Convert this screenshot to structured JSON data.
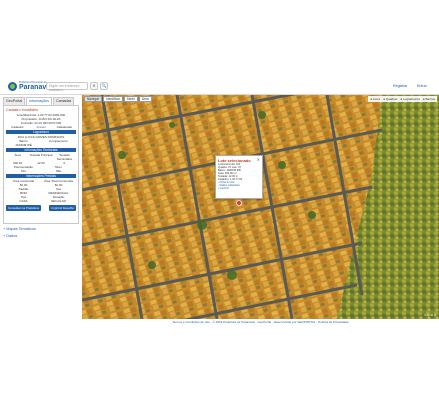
{
  "header": {
    "logo_small": "Prefeitura Municipal de",
    "logo_big": "Paranavaí",
    "search_placeholder": "Digite um endereço, cadastro...",
    "search_btn": "✕",
    "search_go": "🔍",
    "register_link": "Registrar",
    "enter_link": "Entrar"
  },
  "sidebar": {
    "tabs": [
      "GeoPortal",
      "Informações",
      "Camadas"
    ],
    "panel_title": "Cadastro Imobiliário",
    "identity": [
      "Lote/Matrícula: 1.00.77.02.0000.000",
      "Proprietário: JOÃO DA SILVA",
      "Inscrição: 01.02.003.0070.000"
    ],
    "cadastro_row": [
      "Cadastro:",
      "Imóvel",
      "Cadastrado"
    ],
    "sec1": "Logradouro",
    "logradouro": "RUA LUCAS GOMES DOMINGOS",
    "bairro_hdr": [
      "Bairro",
      "Complemento"
    ],
    "bairro_val": [
      "JARDIM IPÊ",
      ""
    ],
    "sec2": "Informações Territoriais",
    "territorio_hdr": [
      "Área",
      "Testada Principal",
      "Testada Secundária"
    ],
    "territorio_val": [
      "300,00",
      "12,00",
      "0"
    ],
    "pav_hdr": [
      "Pavimentação",
      "Muro"
    ],
    "pav_val": [
      "Sim",
      "Não"
    ],
    "sec3": "Informações Prediais",
    "predio_hdr": [
      "Área construída",
      "Área Total Construída"
    ],
    "predio_val": [
      "82,00",
      "82,00"
    ],
    "padrao_hdr": [
      "Padrão",
      "Uso"
    ],
    "padrao_val": [
      "BOM",
      "RESIDENCIAL"
    ],
    "tipo_hdr": [
      "Tipo",
      "Situação"
    ],
    "tipo_val": [
      "CASA",
      "REGULAR"
    ],
    "btn_left": "Consultar na Prefeitura",
    "btn_right": "Imprimir Espelho",
    "collapsed": [
      "Mapas Temáticos",
      "Dados"
    ]
  },
  "map": {
    "toolbar": [
      "Navegar",
      "Identificar",
      "Medir",
      "Área"
    ],
    "layers": [
      "● Lotes",
      "● Quadras",
      "● Logradouros",
      "● Bairros"
    ],
    "popup": {
      "title": "Lote selecionado",
      "lines": [
        "Lote/matrícula: 102",
        "Quadra: 07 Lote: 07",
        "Bairro: JARDIM IPÊ",
        "Área: 300,00 m²",
        "Testada: 12,00 m",
        "Cadastro: 1.00.77.02"
      ],
      "links": [
        "› Ficha do lote",
        "› Dados cadastrais",
        "› Imprimir"
      ]
    },
    "scale": "0     20     40 m"
  },
  "footer": {
    "text": "Termos e Condições de Uso · © 2023 Prefeitura de Paranavaí · GeoPortal · desenvolvido por GEOPORTAL · Política de Privacidade"
  }
}
